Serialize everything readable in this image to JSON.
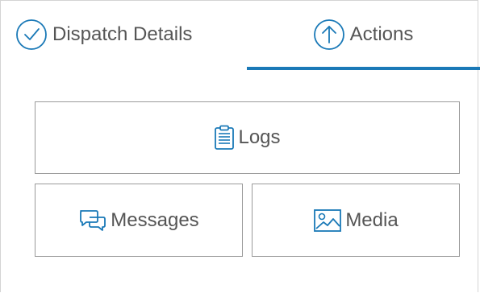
{
  "tabs": {
    "dispatch_details": {
      "label": "Dispatch Details",
      "icon": "check-circle-icon"
    },
    "actions": {
      "label": "Actions",
      "icon": "arrow-up-circle-icon",
      "active": true
    }
  },
  "actions": {
    "logs": {
      "label": "Logs",
      "icon": "clipboard-icon"
    },
    "messages": {
      "label": "Messages",
      "icon": "chat-bubbles-icon"
    },
    "media": {
      "label": "Media",
      "icon": "image-icon"
    }
  },
  "colors": {
    "accent": "#1a79b7",
    "text": "#555555",
    "border": "#9a9a9a"
  }
}
